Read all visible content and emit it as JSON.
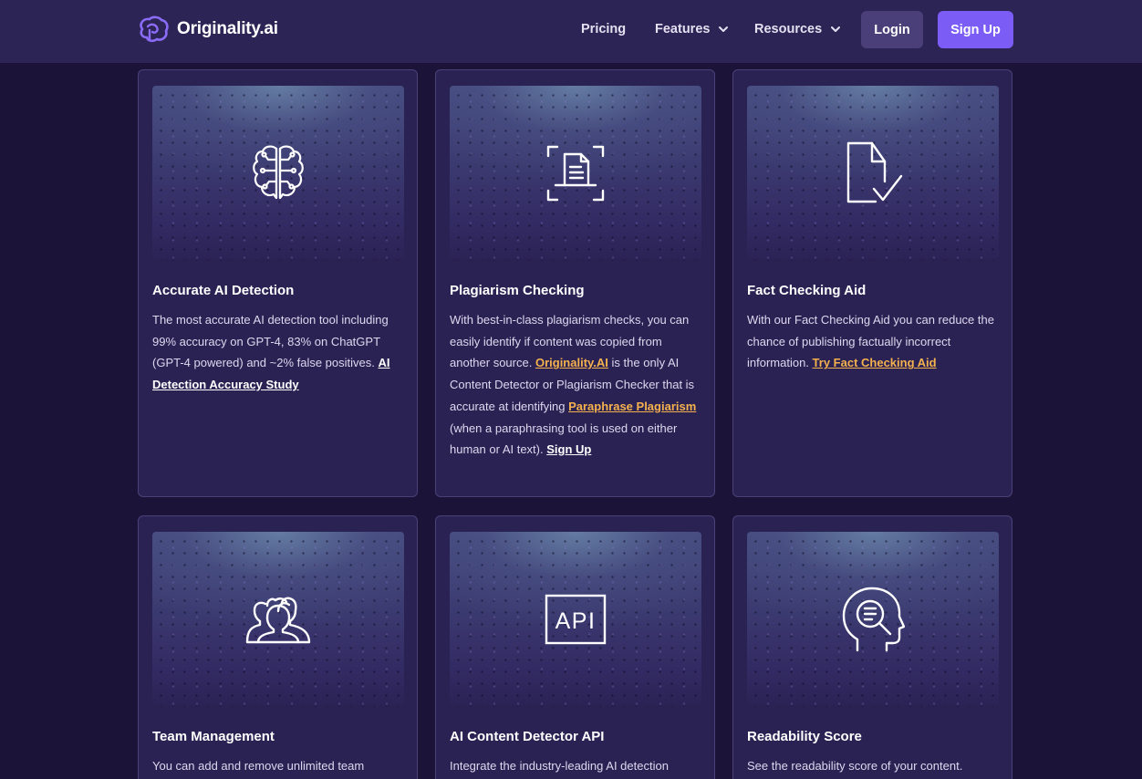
{
  "nav": {
    "brand": "Originality.ai",
    "links": [
      "Pricing",
      "Features",
      "Resources"
    ],
    "login": "Login",
    "signup": "Sign Up"
  },
  "cards": [
    {
      "title": "Accurate AI Detection",
      "icon": "brain-circuit-icon",
      "text": "The most accurate AI detection tool including 99% accuracy on GPT-4, 83% on ChatGPT (GPT-4 powered) and ~2% false positives.",
      "link": "AI Detection Accuracy Study"
    },
    {
      "title": "Plagiarism Checking",
      "icon": "document-scan-icon",
      "text1": "With best-in-class plagiarism checks, you can easily identify if content was copied from another source.",
      "link1": "Originality.AI",
      "text2": "is the only AI Content Detector or Plagiarism Checker that is accurate at identifying",
      "link2": "Paraphrase Plagiarism",
      "text3": "(when a paraphrasing tool is used on either human or AI text).",
      "link3": "Sign Up"
    },
    {
      "title": "Fact Checking Aid",
      "icon": "document-check-icon",
      "text": "With our Fact Checking Aid you can reduce the chance of publishing factually incorrect information.",
      "link": "Try Fact Checking Aid"
    },
    {
      "title": "Team Management",
      "icon": "team-users-icon",
      "text": "You can add and remove unlimited team"
    },
    {
      "title": "AI Content Detector API",
      "icon": "api-icon",
      "icon_text": "API",
      "text": "Integrate the industry-leading AI detection"
    },
    {
      "title": "Readability Score",
      "icon": "head-search-icon",
      "text": "See the readability score of your content."
    }
  ],
  "colors": {
    "background": "#1c1438",
    "navbar": "#2d2456",
    "card": "#2b2254",
    "accent": "#7b5cf5",
    "link_orange": "#f4b14e"
  }
}
